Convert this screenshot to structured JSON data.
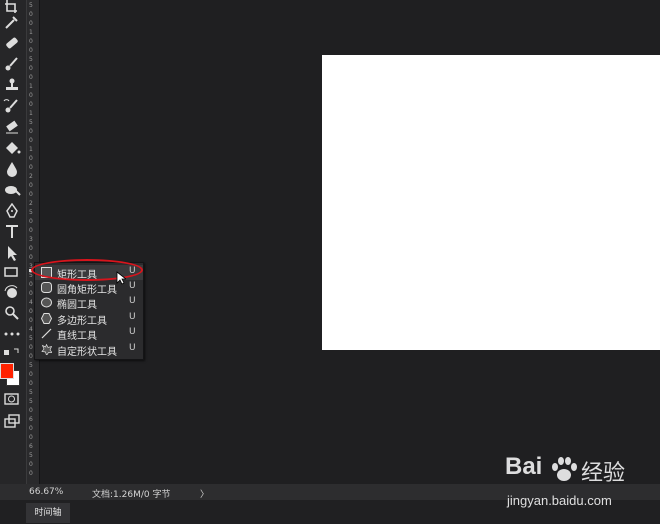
{
  "status_bar": {
    "zoom": "66.67%",
    "document_info": "文档:1.26M/0 字节",
    "arrow": "〉"
  },
  "timeline": {
    "tab_label": "时间轴"
  },
  "ruler": {
    "ticks": [
      "5",
      "0",
      "0",
      "1",
      "0",
      "0",
      "5",
      "0",
      "0",
      "1",
      "0",
      "0",
      "1",
      "5",
      "0",
      "0",
      "1",
      "0",
      "0",
      "2",
      "0",
      "0",
      "2",
      "5",
      "0",
      "0",
      "3",
      "0",
      "0",
      "3",
      "5",
      "0",
      "0",
      "4",
      "0",
      "0",
      "4",
      "5",
      "0",
      "0",
      "5",
      "0",
      "0",
      "5",
      "5",
      "0",
      "6",
      "0",
      "0",
      "6",
      "5",
      "0",
      "0"
    ]
  },
  "flyout": {
    "items": [
      {
        "label": "矩形工具",
        "key": "U",
        "icon": "rectangle-icon"
      },
      {
        "label": "圆角矩形工具",
        "key": "U",
        "icon": "rounded-rectangle-icon"
      },
      {
        "label": "椭圆工具",
        "key": "U",
        "icon": "ellipse-icon"
      },
      {
        "label": "多边形工具",
        "key": "U",
        "icon": "polygon-icon"
      },
      {
        "label": "直线工具",
        "key": "U",
        "icon": "line-icon"
      },
      {
        "label": "自定形状工具",
        "key": "U",
        "icon": "custom-shape-icon"
      }
    ]
  },
  "colors": {
    "foreground": "#ff2200",
    "background": "#ffffff",
    "highlight": "#d9141c"
  },
  "watermark": {
    "brand_left": "Bai",
    "brand_right": "经验",
    "url": "jingyan.baidu.com"
  }
}
